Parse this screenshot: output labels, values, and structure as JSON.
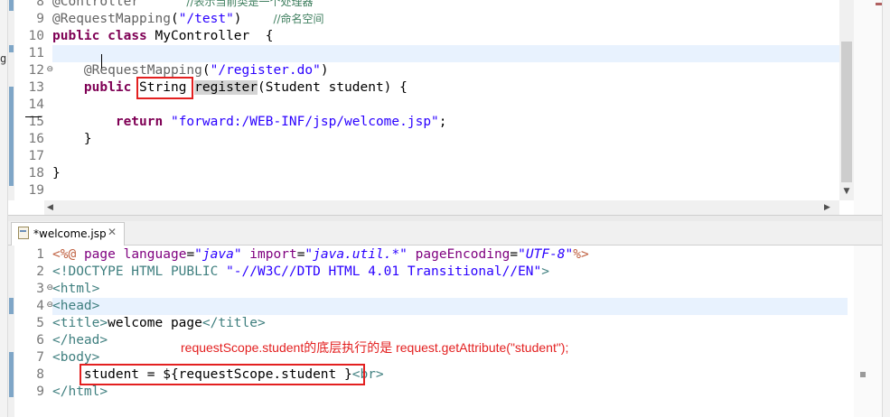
{
  "left_edge": {
    "letter": "g"
  },
  "java_editor": {
    "lines": [
      {
        "n": "8",
        "parts": [
          {
            "c": "ann",
            "t": "@Controller"
          },
          {
            "c": "plain",
            "t": "      "
          },
          {
            "c": "cmt",
            "t": "//表示当前类是一个处理器"
          }
        ]
      },
      {
        "n": "9",
        "parts": [
          {
            "c": "ann",
            "t": "@RequestMapping"
          },
          {
            "c": "plain",
            "t": "("
          },
          {
            "c": "str",
            "t": "\"/test\""
          },
          {
            "c": "plain",
            "t": ")    "
          },
          {
            "c": "cmt",
            "t": "//命名空间"
          }
        ]
      },
      {
        "n": "10",
        "parts": [
          {
            "c": "kw",
            "t": "public"
          },
          {
            "c": "plain",
            "t": " "
          },
          {
            "c": "kw",
            "t": "class"
          },
          {
            "c": "plain",
            "t": " MyController  {"
          }
        ]
      },
      {
        "n": "11",
        "parts": [
          {
            "c": "plain",
            "t": ""
          }
        ]
      },
      {
        "n": "12",
        "fold": "⊖",
        "parts": [
          {
            "c": "plain",
            "t": "    "
          },
          {
            "c": "ann",
            "t": "@RequestMapping"
          },
          {
            "c": "plain",
            "t": "("
          },
          {
            "c": "str",
            "t": "\"/register.do\""
          },
          {
            "c": "plain",
            "t": ")"
          }
        ]
      },
      {
        "n": "13",
        "parts": [
          {
            "c": "plain",
            "t": "    "
          },
          {
            "c": "kw",
            "t": "public"
          },
          {
            "c": "plain",
            "t": " String "
          },
          {
            "c": "hl-sel",
            "t": "register"
          },
          {
            "c": "plain",
            "t": "(Student student) {"
          }
        ]
      },
      {
        "n": "14",
        "parts": [
          {
            "c": "plain",
            "t": ""
          }
        ]
      },
      {
        "n": "15",
        "parts": [
          {
            "c": "plain",
            "t": "        "
          },
          {
            "c": "kw",
            "t": "return"
          },
          {
            "c": "plain",
            "t": " "
          },
          {
            "c": "str",
            "t": "\"forward:/WEB-INF/jsp/welcome.jsp\""
          },
          {
            "c": "plain",
            "t": ";"
          }
        ]
      },
      {
        "n": "16",
        "parts": [
          {
            "c": "plain",
            "t": "    }"
          }
        ]
      },
      {
        "n": "17",
        "parts": [
          {
            "c": "plain",
            "t": ""
          }
        ]
      },
      {
        "n": "18",
        "parts": [
          {
            "c": "plain",
            "t": "}"
          }
        ]
      },
      {
        "n": "19",
        "parts": [
          {
            "c": "plain",
            "t": ""
          }
        ]
      }
    ],
    "scroll_arrows": {
      "down": "▼",
      "left": "◀",
      "right": "▶"
    }
  },
  "tabs": [
    {
      "label": "*welcome.jsp",
      "close": "✕",
      "active": true
    }
  ],
  "jsp_editor": {
    "lines": [
      {
        "n": "1",
        "parts": [
          {
            "c": "dir",
            "t": "<%@"
          },
          {
            "c": "plain",
            "t": " "
          },
          {
            "c": "attr",
            "t": "page"
          },
          {
            "c": "plain",
            "t": " "
          },
          {
            "c": "attr",
            "t": "language"
          },
          {
            "c": "plain",
            "t": "="
          },
          {
            "c": "aval",
            "t": "\"java\""
          },
          {
            "c": "plain",
            "t": " "
          },
          {
            "c": "attr",
            "t": "import"
          },
          {
            "c": "plain",
            "t": "="
          },
          {
            "c": "aval",
            "t": "\"java.util.*\""
          },
          {
            "c": "plain",
            "t": " "
          },
          {
            "c": "attr",
            "t": "pageEncoding"
          },
          {
            "c": "plain",
            "t": "="
          },
          {
            "c": "aval",
            "t": "\"UTF-8\""
          },
          {
            "c": "dir",
            "t": "%>"
          }
        ]
      },
      {
        "n": "2",
        "parts": [
          {
            "c": "tag",
            "t": "<!DOCTYPE HTML PUBLIC "
          },
          {
            "c": "str",
            "t": "\"-//W3C//DTD HTML 4.01 Transitional//EN\""
          },
          {
            "c": "tag",
            "t": ">"
          }
        ]
      },
      {
        "n": "3",
        "fold": "⊖",
        "parts": [
          {
            "c": "tag",
            "t": "<html>"
          }
        ]
      },
      {
        "n": "4",
        "fold": "⊖",
        "parts": [
          {
            "c": "tag",
            "t": "<head>"
          }
        ]
      },
      {
        "n": "5",
        "parts": [
          {
            "c": "tag",
            "t": "<title>"
          },
          {
            "c": "plain",
            "t": "welcome page"
          },
          {
            "c": "tag",
            "t": "</title>"
          }
        ]
      },
      {
        "n": "6",
        "parts": [
          {
            "c": "tag",
            "t": "</head>"
          }
        ]
      },
      {
        "n": "7",
        "parts": [
          {
            "c": "tag",
            "t": "<body>"
          }
        ]
      },
      {
        "n": "8",
        "parts": [
          {
            "c": "plain",
            "t": "    student = ${requestScope.student }"
          },
          {
            "c": "tag",
            "t": "<br>"
          }
        ]
      },
      {
        "n": "9",
        "parts": [
          {
            "c": "tag",
            "t": "</html>"
          }
        ]
      }
    ]
  },
  "annotation": {
    "note": "requestScope.student的底层执行的是 request.getAttribute(\"student\");"
  },
  "colors": {
    "annotation_red": "#e32020",
    "current_line": "#e8f2fe"
  }
}
